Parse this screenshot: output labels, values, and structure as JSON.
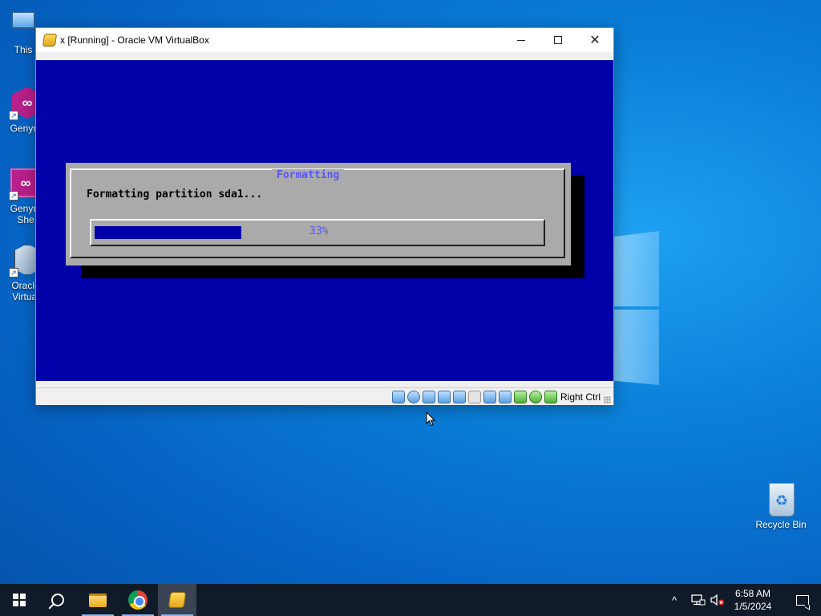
{
  "desktop": {
    "icons": [
      {
        "label": "This"
      },
      {
        "label": "Genym"
      },
      {
        "label": "Genym\nShe"
      },
      {
        "label": "Oracle\nVirtual"
      },
      {
        "label": "Recycle Bin"
      }
    ]
  },
  "window": {
    "title": "x [Running] - Oracle VM VirtualBox",
    "minimize_glyph": "—",
    "maximize_glyph": "☐",
    "close_glyph": "✕"
  },
  "vm": {
    "dialog_title": "Formatting",
    "message": "Formatting partition sda1...",
    "progress_percent": 33,
    "progress_label": "33%",
    "colors": {
      "background": "#0000a8",
      "dialog": "#aaaaaa",
      "accent_text": "#5555ff"
    }
  },
  "statusbar": {
    "icons": [
      "hard-disk-icon",
      "optical-drive-icon",
      "audio-icon",
      "network-icon",
      "usb-icon",
      "shared-folders-icon",
      "display-icon",
      "recording-icon",
      "cpu-icon",
      "mouse-integration-icon",
      "keyboard-icon"
    ],
    "host_key": "Right Ctrl"
  },
  "taskbar": {
    "clock_time": "6:58 AM",
    "clock_date": "1/5/2024",
    "tray_chevron": "^"
  }
}
